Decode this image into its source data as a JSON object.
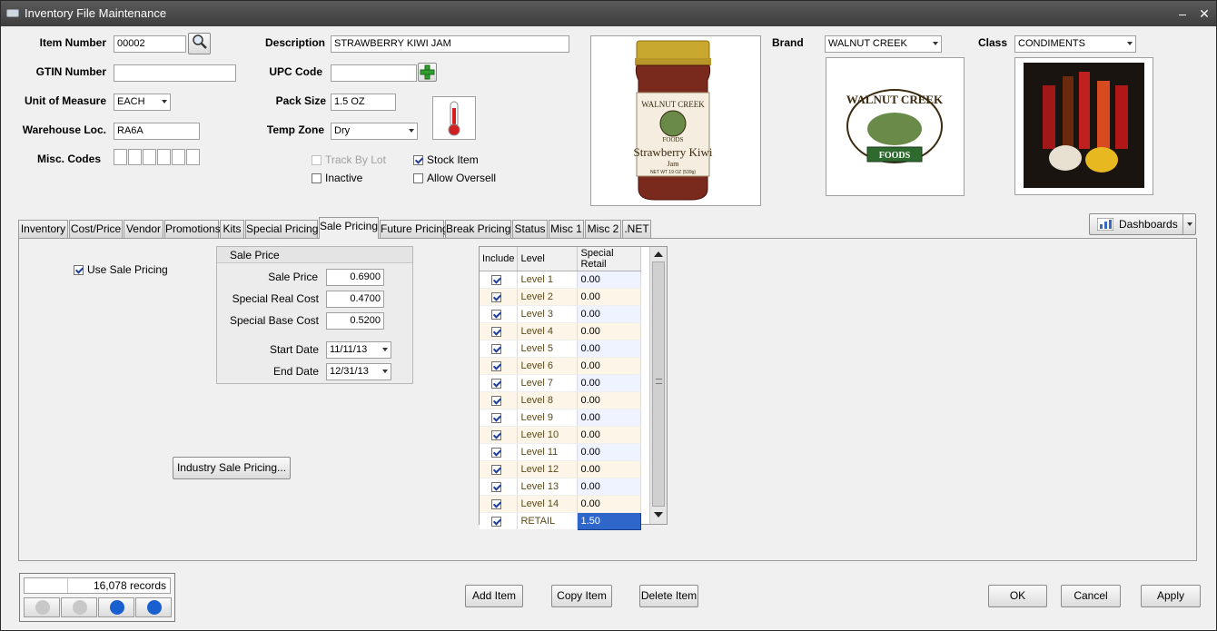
{
  "window": {
    "title": "Inventory File Maintenance"
  },
  "header": {
    "item_number_label": "Item Number",
    "item_number": "00002",
    "gtin_label": "GTIN Number",
    "gtin": "",
    "uom_label": "Unit of Measure",
    "uom": "EACH",
    "warehouse_label": "Warehouse Loc.",
    "warehouse": "RA6A",
    "misc_codes_label": "Misc. Codes",
    "description_label": "Description",
    "description": "STRAWBERRY KIWI JAM",
    "upc_label": "UPC Code",
    "upc": "",
    "pack_size_label": "Pack Size",
    "pack_size": "1.5 OZ",
    "temp_zone_label": "Temp Zone",
    "temp_zone": "Dry",
    "track_by_lot": "Track By Lot",
    "stock_item": "Stock Item",
    "inactive": "Inactive",
    "allow_oversell": "Allow Oversell",
    "brand_label": "Brand",
    "brand": "WALNUT CREEK",
    "class_label": "Class",
    "class": "CONDIMENTS"
  },
  "product_image": {
    "label_top": "WALNUT CREEK",
    "label_main": "Strawberry Kiwi",
    "label_sub": "Jam",
    "label_foods": "FOODS",
    "label_weight": "NET WT 19 OZ (539g)"
  },
  "brand_logo": {
    "top": "WALNUT CREEK",
    "bottom": "FOODS"
  },
  "tabs": [
    {
      "label": "Inventory"
    },
    {
      "label": "Cost/Price"
    },
    {
      "label": "Vendor"
    },
    {
      "label": "Promotions"
    },
    {
      "label": "Kits"
    },
    {
      "label": "Special Pricing"
    },
    {
      "label": "Sale Pricing"
    },
    {
      "label": "Future Pricing"
    },
    {
      "label": "Break Pricing"
    },
    {
      "label": "Status"
    },
    {
      "label": "Misc 1"
    },
    {
      "label": "Misc 2"
    },
    {
      "label": ".NET"
    }
  ],
  "dashboards_label": "Dashboards",
  "sale": {
    "use_sale_pricing": "Use Sale Pricing",
    "group_title": "Sale Price",
    "sale_price_label": "Sale Price",
    "sale_price": "0.6900",
    "special_real_cost_label": "Special Real Cost",
    "special_real_cost": "0.4700",
    "special_base_cost_label": "Special Base Cost",
    "special_base_cost": "0.5200",
    "start_date_label": "Start Date",
    "start_date": "11/11/13",
    "end_date_label": "End Date",
    "end_date": "12/31/13",
    "industry_button": "Industry Sale Pricing..."
  },
  "levels_grid": {
    "headers": [
      "Include",
      "Level",
      "Special Retail"
    ],
    "rows": [
      {
        "level": "Level 1",
        "retail": "0.00"
      },
      {
        "level": "Level 2",
        "retail": "0.00"
      },
      {
        "level": "Level 3",
        "retail": "0.00"
      },
      {
        "level": "Level 4",
        "retail": "0.00"
      },
      {
        "level": "Level 5",
        "retail": "0.00"
      },
      {
        "level": "Level 6",
        "retail": "0.00"
      },
      {
        "level": "Level 7",
        "retail": "0.00"
      },
      {
        "level": "Level 8",
        "retail": "0.00"
      },
      {
        "level": "Level 9",
        "retail": "0.00"
      },
      {
        "level": "Level 10",
        "retail": "0.00"
      },
      {
        "level": "Level 11",
        "retail": "0.00"
      },
      {
        "level": "Level 12",
        "retail": "0.00"
      },
      {
        "level": "Level 13",
        "retail": "0.00"
      },
      {
        "level": "Level 14",
        "retail": "0.00"
      },
      {
        "level": "RETAIL",
        "retail": "1.50"
      }
    ]
  },
  "footer": {
    "records": "16,078 records",
    "add_item": "Add Item",
    "copy_item": "Copy Item",
    "delete_item": "Delete Item",
    "ok": "OK",
    "cancel": "Cancel",
    "apply": "Apply"
  }
}
